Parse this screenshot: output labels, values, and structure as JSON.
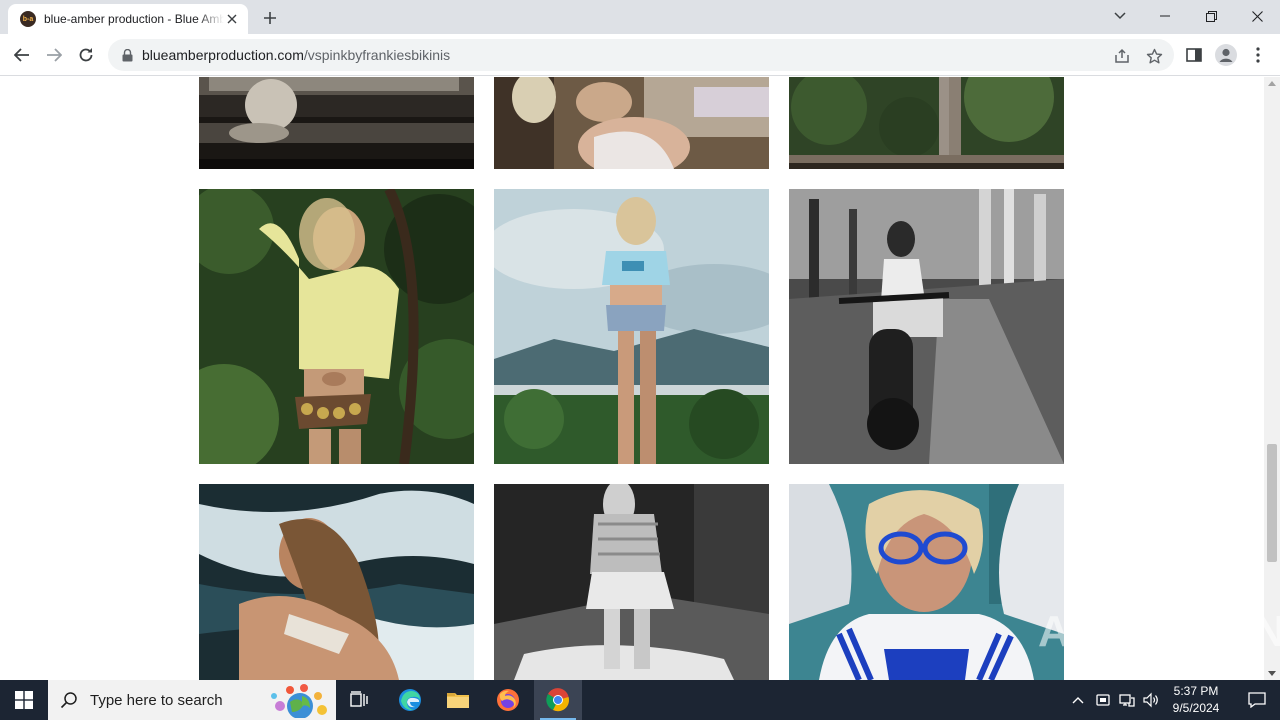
{
  "browser": {
    "tab": {
      "favicon_text": "b-a",
      "title": "blue-amber production - Blue Amber"
    },
    "url": {
      "host": "blueamberproduction.com",
      "path": "/vspinkbyfrankiesbikinis"
    }
  },
  "gallery": {
    "photos": [
      {
        "description": "woman kneeling on window seat, black and white"
      },
      {
        "description": "woman in white shorts near doorway"
      },
      {
        "description": "legs standing on wooden railing, jungle"
      },
      {
        "description": "woman in yellow hoodie and coin belt in jungle"
      },
      {
        "description": "woman in blue crop top and denim shorts on hill"
      },
      {
        "description": "woman riding e-bike on dirt road, black and white"
      },
      {
        "description": "woman sitting by waterfall"
      },
      {
        "description": "woman in skirt at river rocks, black and white"
      },
      {
        "description": "woman with blue glasses and jersey"
      }
    ]
  },
  "watermark": {
    "left": "ANY",
    "right": "RUN"
  },
  "taskbar": {
    "search_placeholder": "Type here to search",
    "time": "5:37 PM",
    "date": "9/5/2024"
  }
}
